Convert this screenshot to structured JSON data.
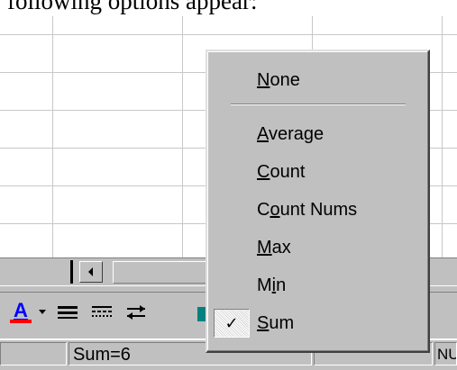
{
  "document": {
    "visible_text": "following options appear:"
  },
  "toolbar": {
    "icons": [
      "font-color-icon",
      "dropdown-arrow-icon",
      "line-style-icon",
      "dash-style-icon",
      "arrow-style-icon",
      "shadow-icon"
    ],
    "font_color_letter": "A",
    "accent_red": "#ff0000",
    "accent_blue": "#0000ff"
  },
  "statusbar": {
    "sum_text": "Sum=6",
    "num_indicator": "NU"
  },
  "context_menu": {
    "items": [
      {
        "pre": "",
        "acc": "N",
        "post": "one",
        "checked": false
      },
      {
        "pre": "",
        "acc": "A",
        "post": "verage",
        "checked": false
      },
      {
        "pre": "",
        "acc": "C",
        "post": "ount",
        "checked": false
      },
      {
        "pre": "C",
        "acc": "o",
        "post": "unt Nums",
        "checked": false
      },
      {
        "pre": "",
        "acc": "M",
        "post": "ax",
        "checked": false
      },
      {
        "pre": "M",
        "acc": "i",
        "post": "n",
        "checked": false
      },
      {
        "pre": "",
        "acc": "S",
        "post": "um",
        "checked": true
      }
    ],
    "check_glyph": "✓"
  }
}
